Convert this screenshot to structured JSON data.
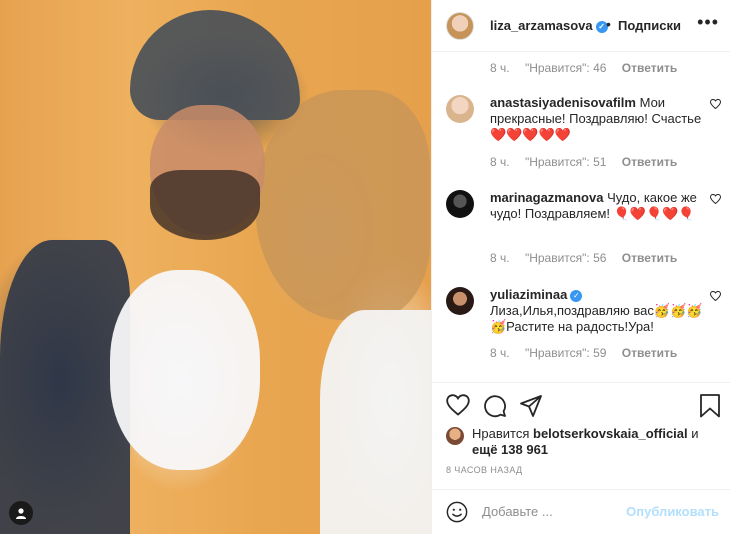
{
  "post": {
    "username": "liza_arzamasova",
    "follow_label": "Подписки",
    "separator": "•",
    "more_label": "•••"
  },
  "caption_meta": {
    "time": "8 ч.",
    "likes": "\"Нравится\": 46",
    "reply": "Ответить"
  },
  "comments": [
    {
      "username": "anastasiyadenisovafilm",
      "text": "Мои прекрасные! Поздравляю! Счастье ❤️❤️❤️❤️❤️",
      "time": "8 ч.",
      "likes": "\"Нравится\": 51",
      "reply": "Ответить",
      "verified": false
    },
    {
      "username": "marinagazmanova",
      "text": "Чудо, какое же чудо! Поздравляем! 🎈❤️🎈❤️🎈",
      "time": "8 ч.",
      "likes": "\"Нравится\": 56",
      "reply": "Ответить",
      "verified": false
    },
    {
      "username": "yuliaziminaa",
      "text": "Лиза,Илья,поздравляю вас🥳🥳🥳🥳Растите на радость!Ура!",
      "time": "8 ч.",
      "likes": "\"Нравится\": 59",
      "reply": "Ответить",
      "verified": true
    }
  ],
  "likes_summary": {
    "prefix": "Нравится",
    "user": "belotserkovskaia_official",
    "middle": "и",
    "more": "ещё 138 961"
  },
  "time_ago": "8 ЧАСОВ НАЗАД",
  "add_comment": {
    "placeholder": "Добавьте ...",
    "post_label": "Опубликовать"
  },
  "icons": {
    "heart": "heart-icon",
    "comment": "comment-icon",
    "share": "share-icon",
    "bookmark": "bookmark-icon",
    "smile": "emoji-icon",
    "tag": "user-tag-icon"
  },
  "colors": {
    "verified": "#3897f0",
    "post_disabled": "#b2dffc"
  }
}
